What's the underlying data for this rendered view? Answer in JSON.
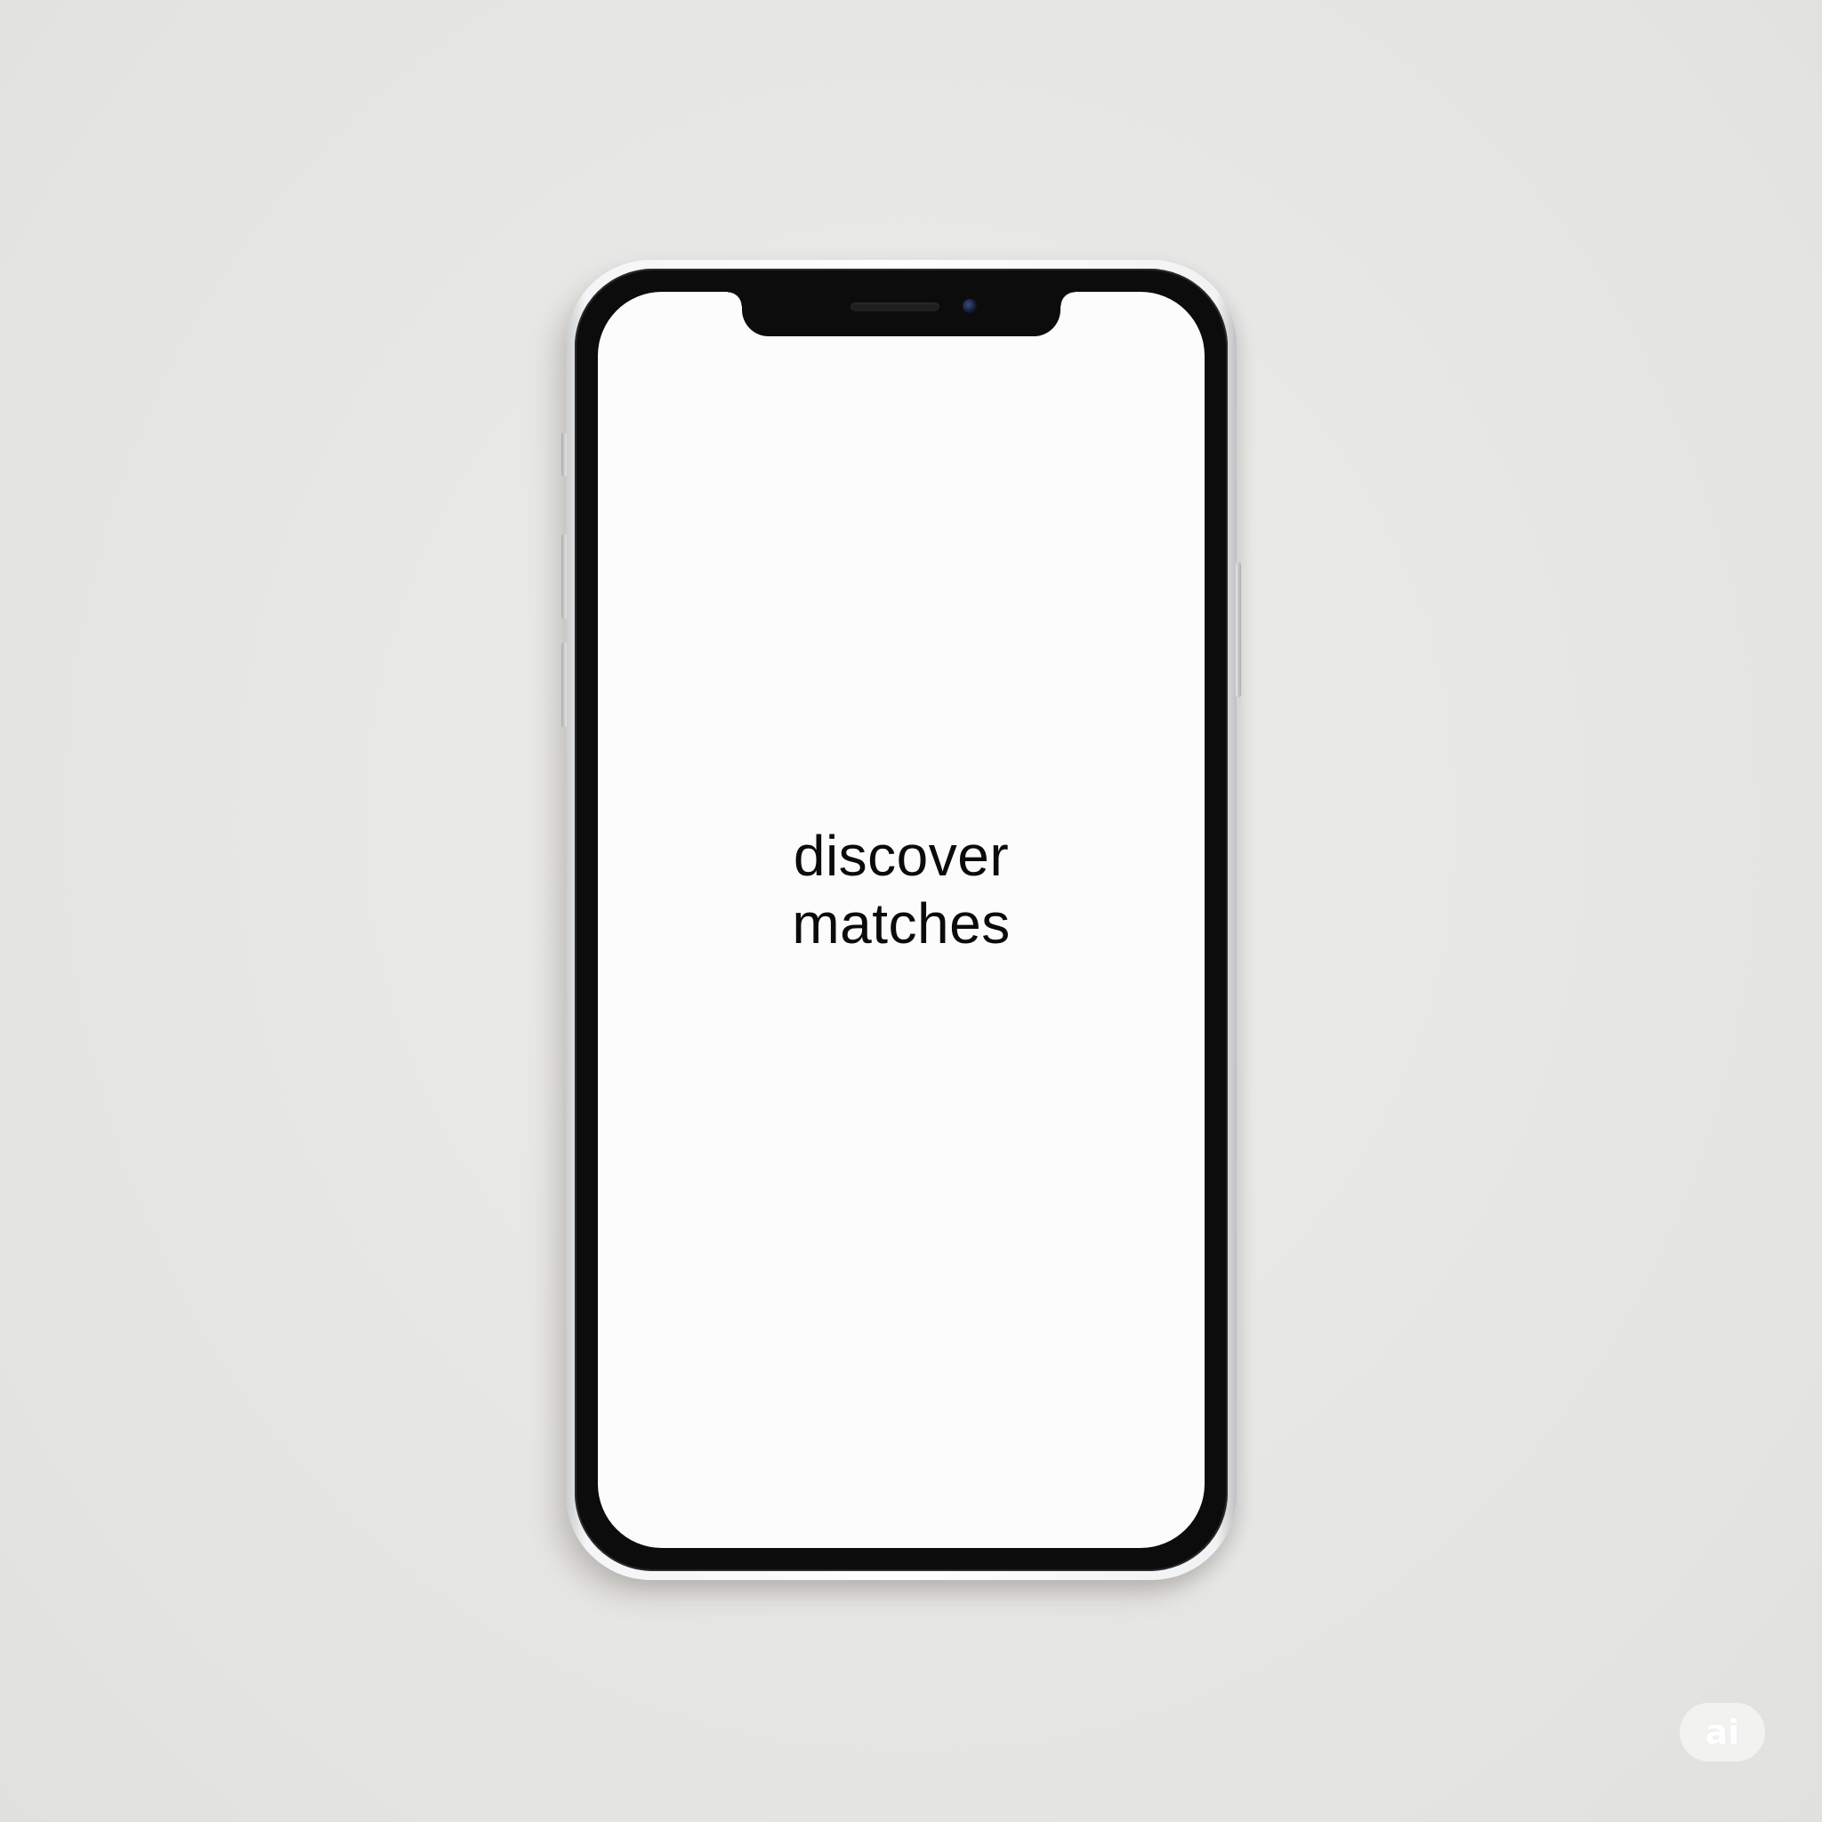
{
  "screen": {
    "headline_line1": "discover",
    "headline_line2": "matches"
  },
  "watermark": {
    "label": "ai"
  },
  "colors": {
    "background": "#e8e8e6",
    "bezel": "#0c0c0c",
    "screen": "#fcfcfc",
    "text": "#0b0b0b"
  }
}
